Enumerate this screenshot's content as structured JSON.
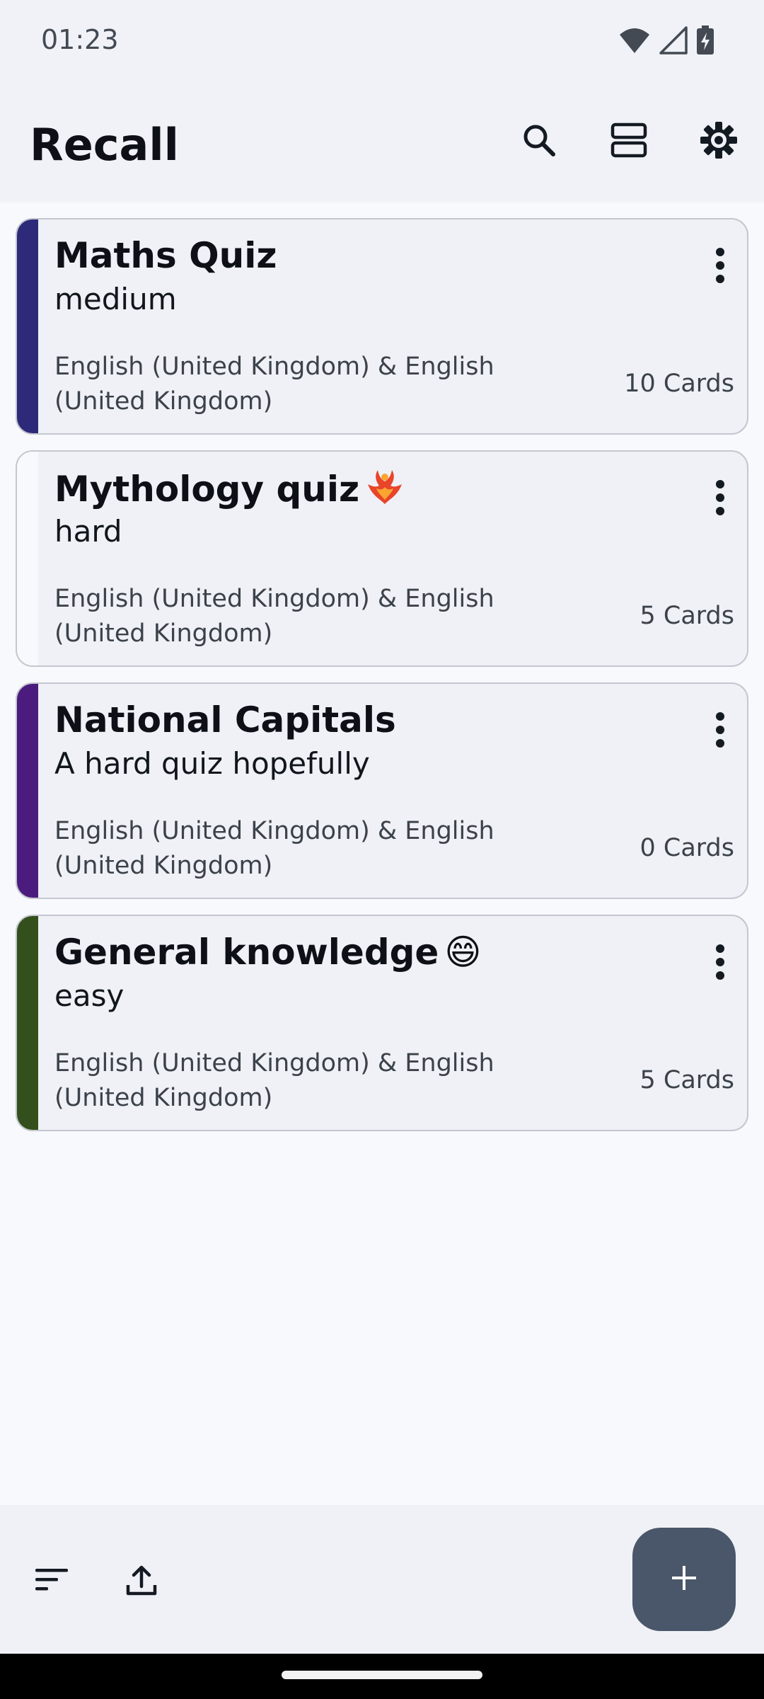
{
  "status_bar": {
    "time": "01:23",
    "icons": [
      "wifi-icon",
      "cellular-signal-icon",
      "battery-charging-icon"
    ]
  },
  "app_bar": {
    "title": "Recall",
    "actions": [
      "search-icon",
      "view-toggle-icon",
      "settings-icon"
    ]
  },
  "decks": [
    {
      "title": "Maths Quiz",
      "emoji": "",
      "description": "medium",
      "languages": "English (United Kingdom) & English (United Kingdom)",
      "count": "10 Cards",
      "color": "#2e2a7a"
    },
    {
      "title": "Mythology quiz",
      "emoji": "🐦‍🔥",
      "description": "hard",
      "languages": "English (United Kingdom) & English (United Kingdom)",
      "count": "5 Cards",
      "color": "#f8f9fc"
    },
    {
      "title": "National Capitals",
      "emoji": "",
      "description": "A hard quiz hopefully",
      "languages": "English (United Kingdom) & English (United Kingdom)",
      "count": "0 Cards",
      "color": "#4b1c7e"
    },
    {
      "title": "General knowledge",
      "emoji": "😄",
      "description": "easy",
      "languages": "English (United Kingdom) & English (United Kingdom)",
      "count": "5 Cards",
      "color": "#33501c"
    }
  ],
  "bottom_bar": {
    "icons": [
      "sort-icon",
      "export-icon"
    ],
    "fab_icon": "add-icon"
  },
  "colors": {
    "background": "#f8f9fc",
    "surface": "#eff1f6",
    "fab": "#4a5669"
  }
}
